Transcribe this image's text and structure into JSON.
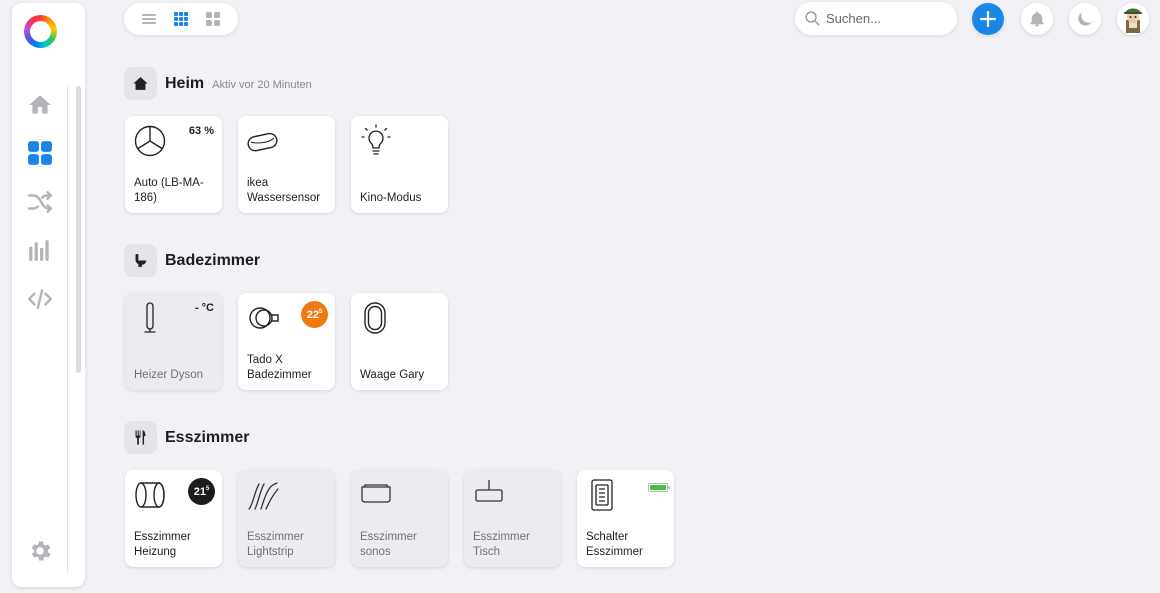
{
  "sidebar": {
    "items": [
      {
        "name": "home-icon",
        "active": false
      },
      {
        "name": "dashboard-grid-icon",
        "active": true
      },
      {
        "name": "shuffle-icon",
        "active": false
      },
      {
        "name": "statistics-icon",
        "active": false
      },
      {
        "name": "code-icon",
        "active": false
      }
    ],
    "settings_icon": "gear-icon"
  },
  "topbar": {
    "view_modes": [
      "list-view-icon",
      "grid-small-view-icon",
      "grid-large-view-icon"
    ],
    "active_view": "grid-small-view-icon",
    "search_placeholder": "Suchen..."
  },
  "colors": {
    "accent": "#1a86e8",
    "active_nav": "#1a86e8",
    "inactive_nav": "#b3b3b8",
    "badge_orange": "#f07a12",
    "badge_dark": "#1c1c1e",
    "battery_green": "#3ec43e"
  },
  "rooms": [
    {
      "title": "Heim",
      "subtitle": "Aktiv vor 20 Minuten",
      "icon": "house-icon",
      "tiles": [
        {
          "label": "Auto (LB-MA-\n186)",
          "icon": "mercedes-star-icon",
          "value": "63 %",
          "inactive": false
        },
        {
          "label": "ikea\nWassersensor",
          "icon": "water-sensor-icon",
          "inactive": false
        },
        {
          "label": "Kino-Modus",
          "icon": "lightbulb-icon",
          "inactive": false
        }
      ]
    },
    {
      "title": "Badezimmer",
      "subtitle": "",
      "icon": "toilet-icon",
      "tiles": [
        {
          "label": "Heizer Dyson",
          "icon": "tower-heater-icon",
          "value": "- °C",
          "inactive": true
        },
        {
          "label": "Tado X\nBadezimmer",
          "icon": "radiator-valve-icon",
          "badge": "22",
          "badge_decimal": "5",
          "badge_color": "#f07a12",
          "inactive": false
        },
        {
          "label": "Waage Gary",
          "icon": "scale-icon",
          "inactive": false
        }
      ]
    },
    {
      "title": "Esszimmer",
      "subtitle": "",
      "icon": "cutlery-icon",
      "tiles": [
        {
          "label": "Esszimmer\nHeizung",
          "icon": "thermostat-cylinder-icon",
          "badge": "21",
          "badge_decimal": "5",
          "badge_color": "#1c1c1e",
          "inactive": false
        },
        {
          "label": "Esszimmer\nLightstrip",
          "icon": "lightstrip-icon",
          "inactive": true
        },
        {
          "label": "Esszimmer\nsonos",
          "icon": "speaker-icon",
          "inactive": true
        },
        {
          "label": "Esszimmer\nTisch",
          "icon": "pendant-lamp-icon",
          "inactive": true
        },
        {
          "label": "Schalter\nEsszimmer",
          "icon": "wall-switch-icon",
          "battery": 1.0,
          "inactive": false
        }
      ]
    }
  ]
}
